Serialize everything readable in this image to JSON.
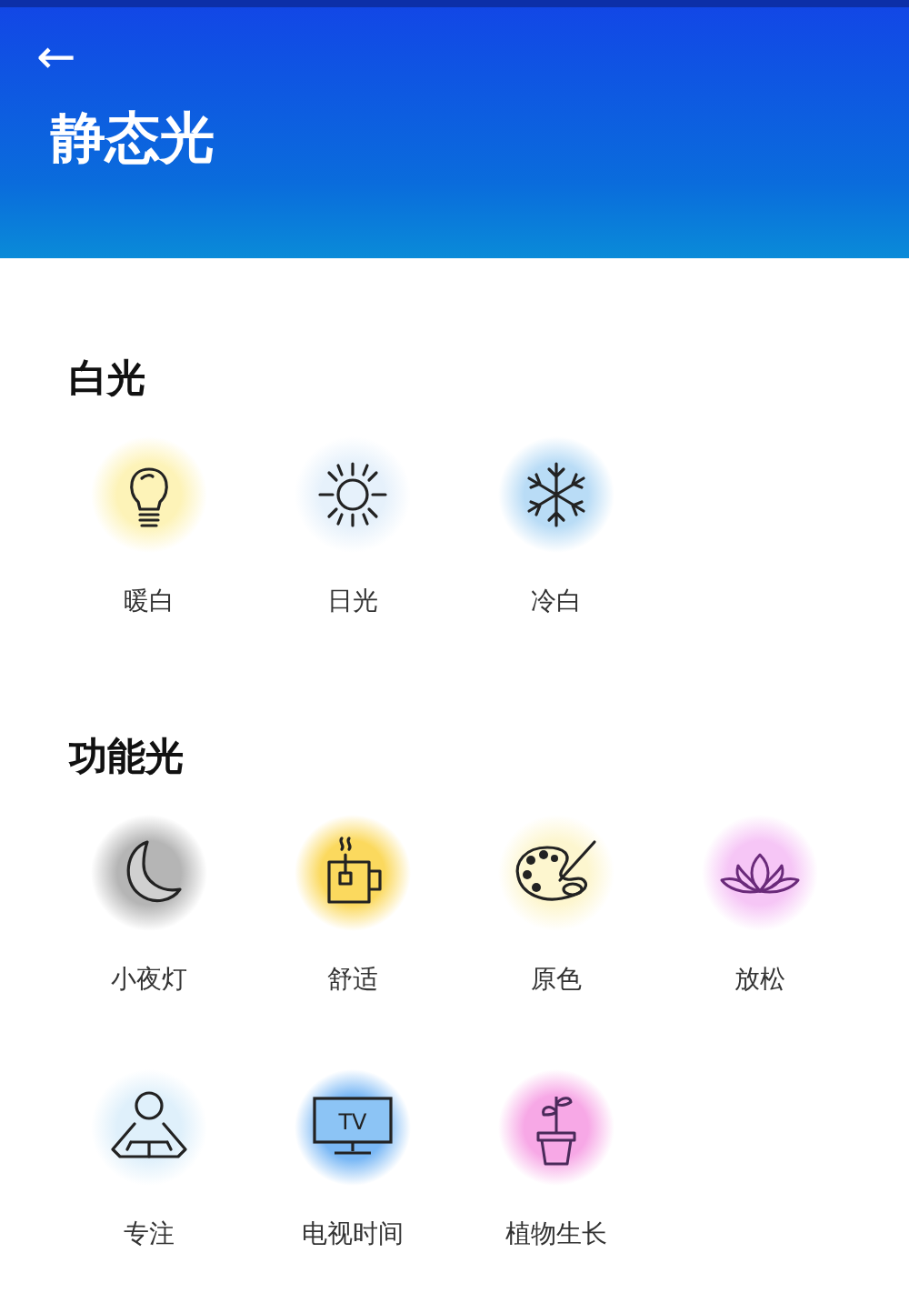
{
  "header": {
    "back": "←",
    "title": "静态光"
  },
  "sections": [
    {
      "title": "白光",
      "items": [
        {
          "label": "暖白",
          "kind": "bulb",
          "color": "#fdf3b8"
        },
        {
          "label": "日光",
          "kind": "sun",
          "color": "#e6f1fb"
        },
        {
          "label": "冷白",
          "kind": "snowflake",
          "color": "#b9dcf6"
        }
      ]
    },
    {
      "title": "功能光",
      "items": [
        {
          "label": "小夜灯",
          "kind": "moon",
          "color": "#b5b5b5"
        },
        {
          "label": "舒适",
          "kind": "tea",
          "color": "#fbd95e"
        },
        {
          "label": "原色",
          "kind": "palette",
          "color": "#fdf6cf"
        },
        {
          "label": "放松",
          "kind": "lotus",
          "color": "#f6c6f6"
        },
        {
          "label": "专注",
          "kind": "reader",
          "color": "#dff0fb"
        },
        {
          "label": "电视时间",
          "kind": "tv",
          "color": "#7ab8f5",
          "icon_text": "TV"
        },
        {
          "label": "植物生长",
          "kind": "plant",
          "color": "#f7a8e6"
        }
      ]
    }
  ]
}
